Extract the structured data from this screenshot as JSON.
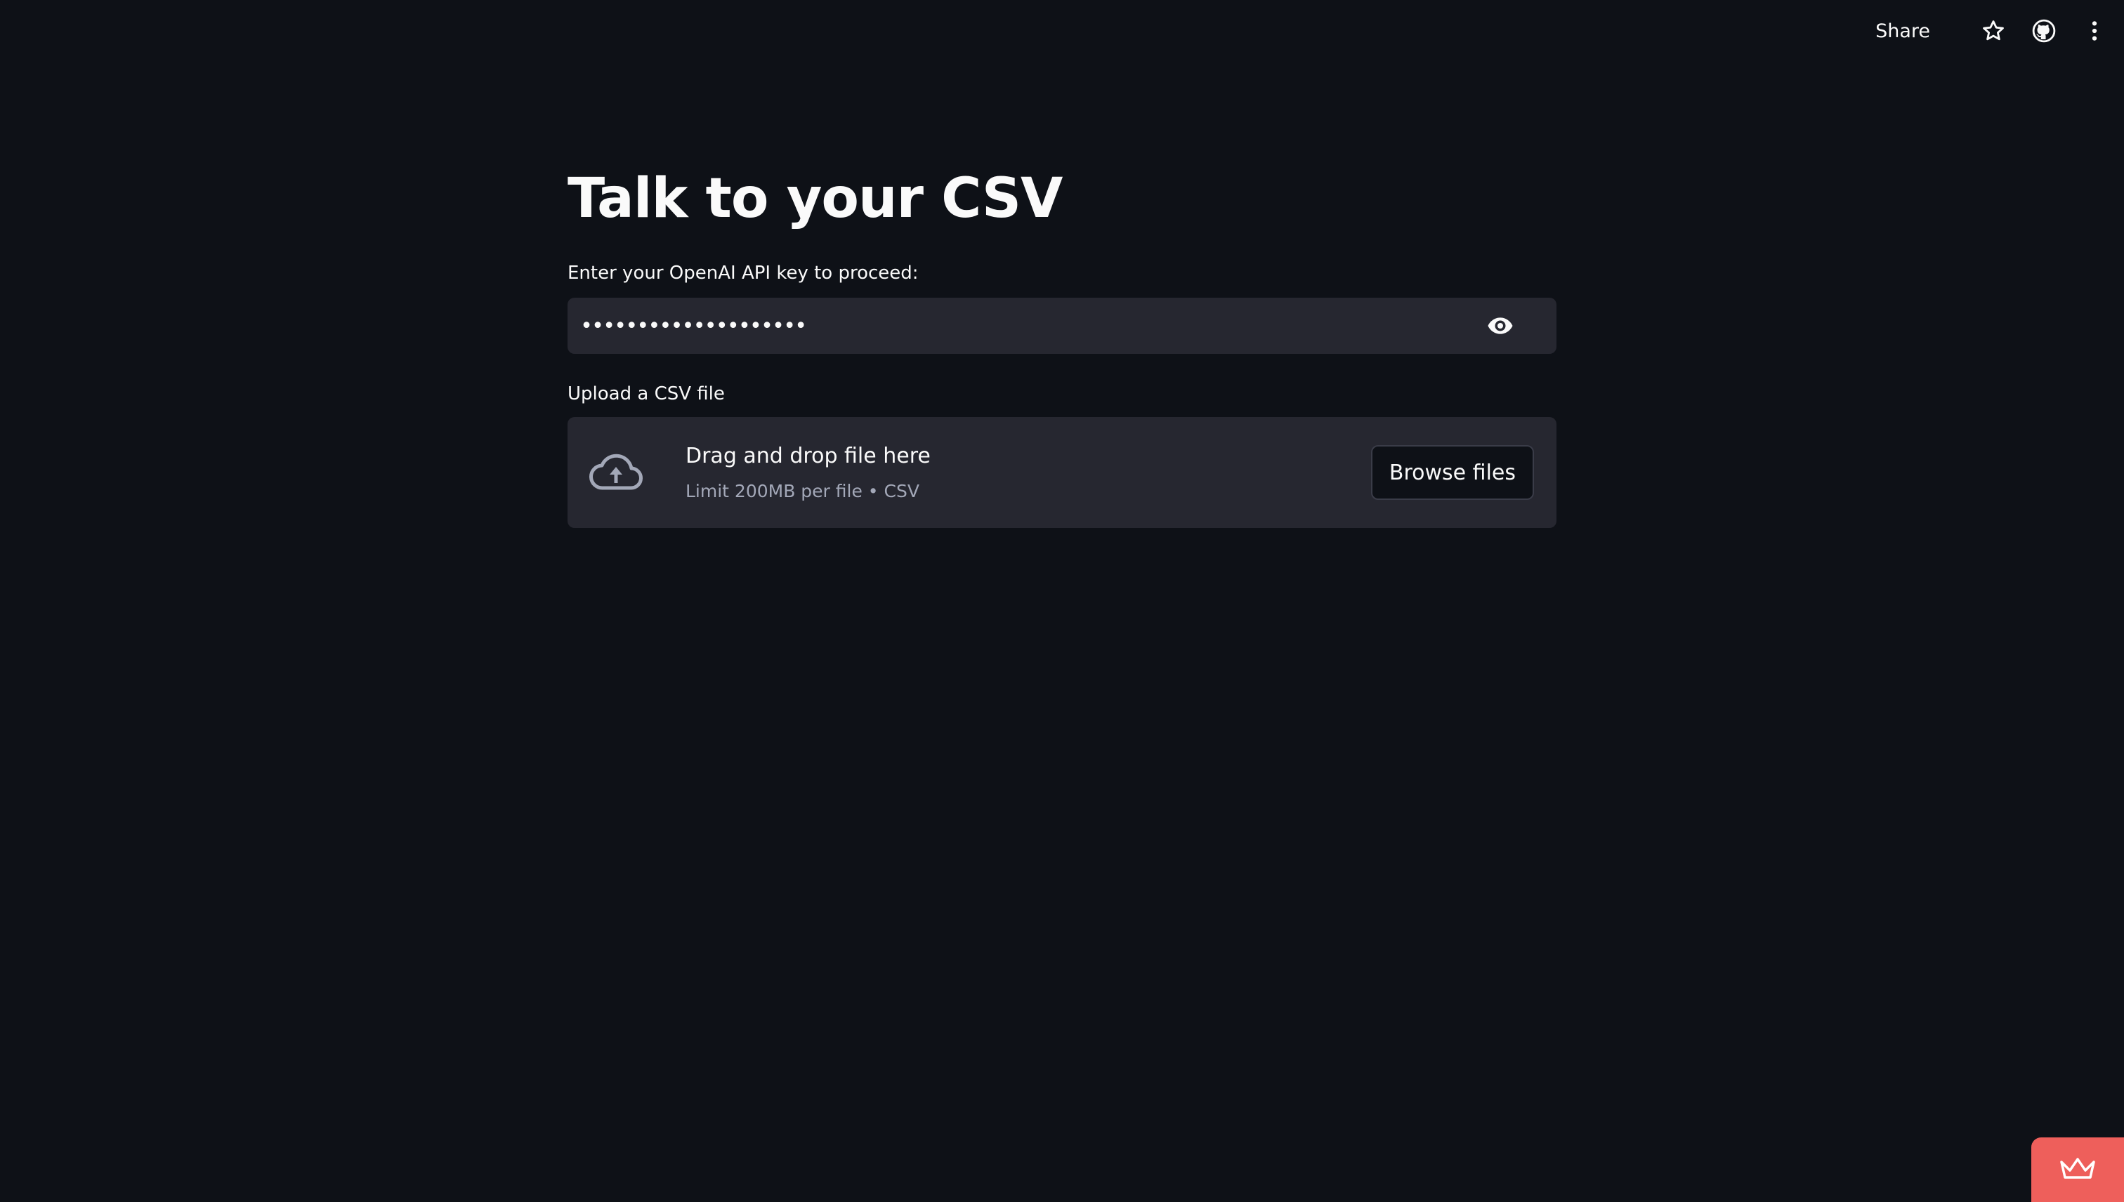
{
  "header": {
    "share_label": "Share",
    "icons": [
      "star-icon",
      "github-icon",
      "more-vertical-icon"
    ]
  },
  "main": {
    "title": "Talk to your CSV",
    "api_key": {
      "label": "Enter your OpenAI API key to proceed:",
      "value": "••••••••••••••••••••",
      "visibility_icon": "eye-icon"
    },
    "uploader": {
      "label": "Upload a CSV file",
      "drag_text": "Drag and drop file here",
      "limit_text": "Limit 200MB per file • CSV",
      "browse_label": "Browse files",
      "icon": "cloud-upload-icon"
    }
  },
  "footer": {
    "badge_icon": "crown-icon"
  },
  "colors": {
    "background": "#0e1117",
    "surface": "#262730",
    "text": "#fafafa",
    "muted_text": "#a3a8b8",
    "badge": "#ee5f5b"
  }
}
